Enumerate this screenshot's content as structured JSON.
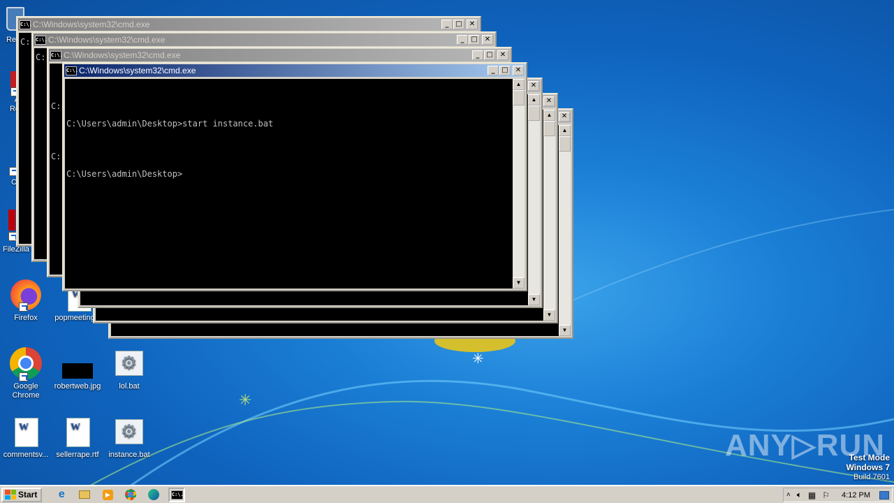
{
  "desktop": {
    "icons": [
      {
        "label": "Re",
        "glyph": "recycle-bin"
      },
      {
        "label": "A\nRe",
        "glyph": "adobe-reader"
      },
      {
        "label": "C",
        "glyph": "ccleaner"
      },
      {
        "label": "FileZilla C",
        "glyph": "filezilla"
      },
      {
        "label": "Firefox",
        "glyph": "firefox"
      },
      {
        "label": "popmeeting",
        "glyph": "word-document"
      },
      {
        "label": "Google\nChrome",
        "glyph": "chrome"
      },
      {
        "label": "robertweb.jpg",
        "glyph": "image-thumbnail"
      },
      {
        "label": "lol.bat",
        "glyph": "batch-file"
      },
      {
        "label": "commentsv...",
        "glyph": "word-document"
      },
      {
        "label": "sellerrape.rtf",
        "glyph": "word-document"
      },
      {
        "label": "instance.bat",
        "glyph": "batch-file"
      }
    ]
  },
  "windows": {
    "title": "C:\\Windows\\system32\\cmd.exe",
    "active_title": "C:\\Windows\\system32\\cmd.exe",
    "background_prompts": [
      "C:",
      "C:",
      "C:",
      "C:"
    ],
    "active_console_lines": [
      "C:\\Users\\admin\\Desktop>start instance.bat",
      "C:\\Users\\admin\\Desktop>"
    ],
    "icon_text": "C:\\.",
    "min_glyph": "_",
    "max_glyph": "□",
    "close_glyph": "✕"
  },
  "taskbar": {
    "start_label": "Start",
    "pinned": [
      "internet-explorer-icon",
      "file-explorer-icon",
      "media-player-icon",
      "chrome-icon",
      "edge-icon",
      "cmd-icon"
    ],
    "clock": "4:12 PM"
  },
  "watermark": {
    "line1": "Test Mode",
    "line2": "Windows 7",
    "line3": "Build 7601"
  },
  "brand": "ANY▷RUN",
  "colors": {
    "title_active": "#0a246a",
    "title_inactive": "#808080",
    "desktop_blue": "#1b7fd6"
  }
}
